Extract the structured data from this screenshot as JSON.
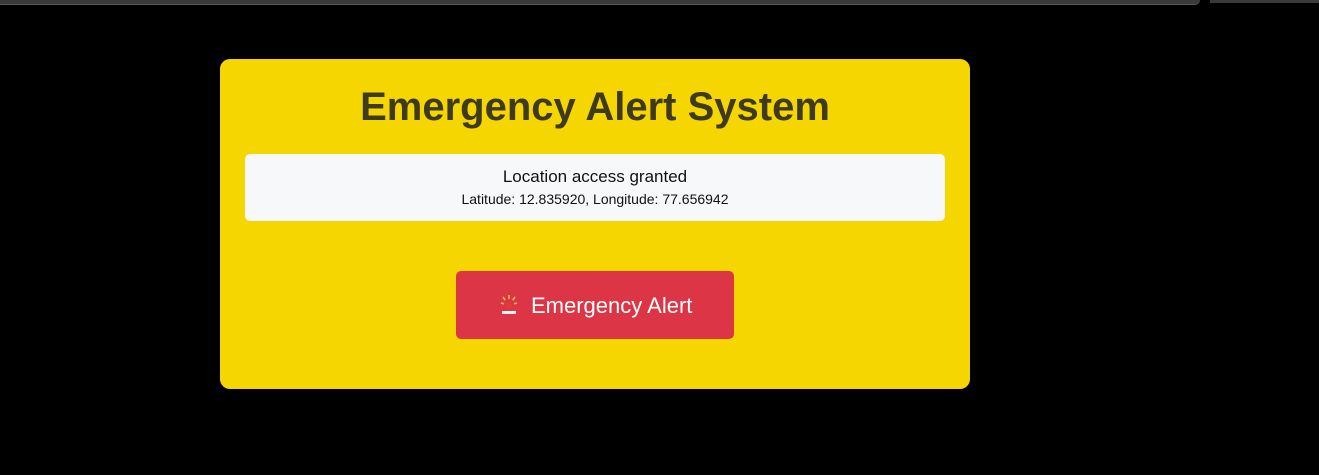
{
  "page": {
    "title": "Emergency Alert System"
  },
  "status": {
    "message": "Location access granted",
    "coordinates": "Latitude: 12.835920, Longitude: 77.656942"
  },
  "alert_button": {
    "label": "Emergency Alert",
    "icon": "siren-icon"
  },
  "colors": {
    "background": "#000000",
    "card": "#f6d600",
    "title": "#3d3a1e",
    "status_box": "#f7f8fa",
    "button": "#dc3545",
    "button_text": "#ffffff"
  }
}
